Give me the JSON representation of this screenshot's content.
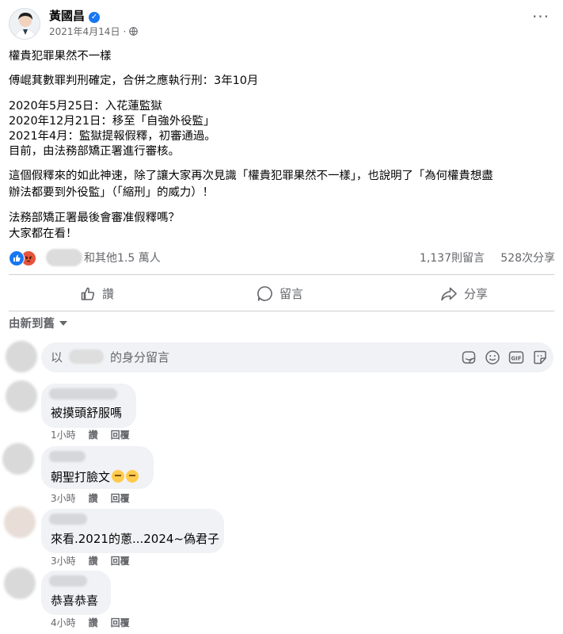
{
  "post": {
    "author": "黃國昌",
    "date": "2021年4月14日",
    "date_separator": "·",
    "lines": [
      "權貴犯罪果然不一樣",
      "傅崐萁數罪判刑確定，合併之應執行刑：3年10月",
      "2020年5月25日：入花蓮監獄",
      "2020年12月21日：移至「自強外役監」",
      "2021年4月：監獄提報假釋，初審通過。",
      "目前，由法務部矯正署進行審核。",
      "這個假釋來的如此神速，除了讓大家再次見識「權貴犯罪果然不一樣」，也說明了「為何權貴想盡",
      "辦法都要到外役監」（「縮刑」的威力）！",
      "法務部矯正署最後會審准假釋嗎？",
      "大家都在看！"
    ]
  },
  "reactions": {
    "others_text": "和其他1.5 萬人",
    "comments_count": "1,137則留言",
    "shares_count": "528次分享",
    "types": [
      "like",
      "angry"
    ]
  },
  "actions": {
    "like_label": "讚",
    "comment_label": "留言",
    "share_label": "分享"
  },
  "sort": {
    "label": "由新到舊"
  },
  "composer": {
    "prefix": "以",
    "suffix": "的身分留言",
    "icons": [
      "sticker-icon",
      "emoji-icon",
      "gif-icon",
      "avatar-sticker-icon"
    ]
  },
  "comments": [
    {
      "text": "被摸頭舒服嗎",
      "time": "1小時",
      "like": "讚",
      "reply": "回覆",
      "emoji_count": 0
    },
    {
      "text": "朝聖打臉文",
      "time": "3小時",
      "like": "讚",
      "reply": "回覆",
      "emoji_count": 2
    },
    {
      "text": "來看.2021的蔥...2024~偽君子",
      "time": "3小時",
      "like": "讚",
      "reply": "回覆",
      "emoji_count": 0
    },
    {
      "text": "恭喜恭喜",
      "time": "4小時",
      "like": "讚",
      "reply": "回覆",
      "emoji_count": 0
    }
  ],
  "colors": {
    "verified": "#1877f2",
    "like": "#1877f2",
    "angry": "#e5543d",
    "secondary_text": "#65676b",
    "bubble": "#f0f2f5"
  }
}
